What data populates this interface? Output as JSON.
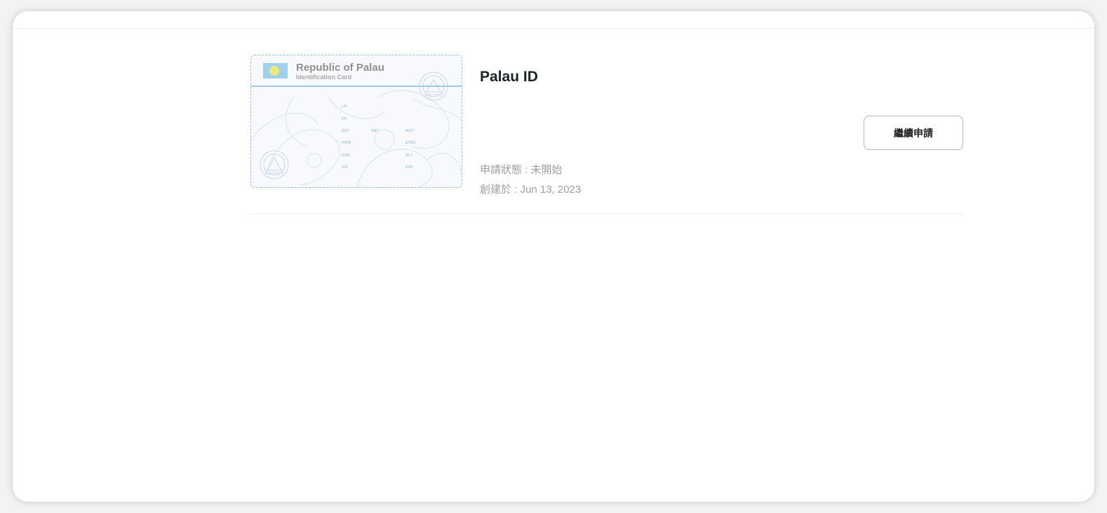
{
  "application": {
    "title": "Palau ID",
    "status_text": "申請狀態 : 未開始",
    "created_text": "創建於 : Jun 13, 2023",
    "continue_label": "繼續申請"
  },
  "id_card": {
    "country": "Republic of Palau",
    "card_type": "Identification Card",
    "fields": {
      "ln": "LN",
      "fn": "FN",
      "sex": "SEX",
      "hgt": "HGT",
      "wgt": "WGT",
      "hair": "HAIR",
      "eyes": "EYES",
      "dob": "DOB",
      "id_no": "ID #",
      "iss": "ISS",
      "exp": "EXP"
    },
    "colors": {
      "flag_blue": "#9fd0ee",
      "flag_moon": "#ece87e",
      "accent_line": "#9ccae9",
      "dashed_border": "#8ec0ec"
    }
  }
}
